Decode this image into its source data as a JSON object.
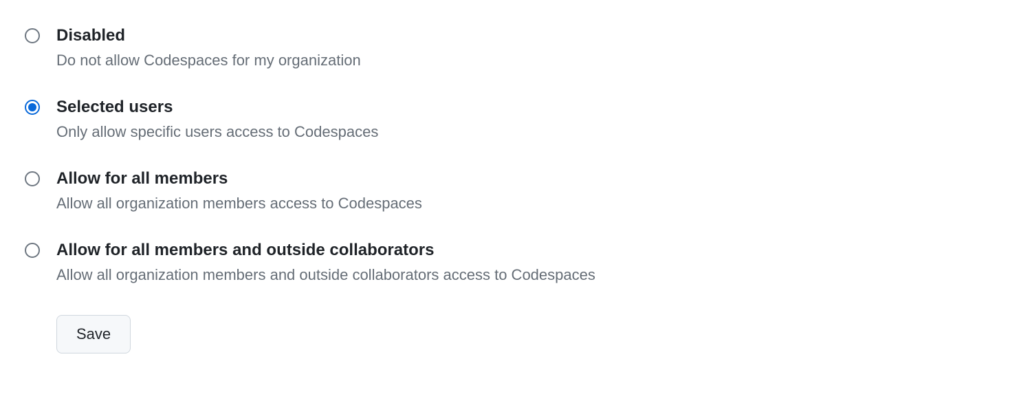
{
  "options": [
    {
      "title": "Disabled",
      "description": "Do not allow Codespaces for my organization",
      "selected": false
    },
    {
      "title": "Selected users",
      "description": "Only allow specific users access to Codespaces",
      "selected": true
    },
    {
      "title": "Allow for all members",
      "description": "Allow all organization members access to Codespaces",
      "selected": false
    },
    {
      "title": "Allow for all members and outside collaborators",
      "description": "Allow all organization members and outside collaborators access to Codespaces",
      "selected": false
    }
  ],
  "actions": {
    "save_label": "Save"
  }
}
